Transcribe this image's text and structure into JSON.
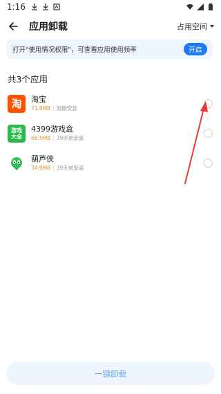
{
  "status_bar": {
    "time": "1:16",
    "left_icons": [
      "download-icon",
      "download-icon",
      "notification-icon"
    ],
    "right_icons": [
      "wifi-icon",
      "signal-icon",
      "battery-icon"
    ]
  },
  "app_bar": {
    "title": "应用卸载",
    "sort_label": "占用空间"
  },
  "banner": {
    "text": "打开\"使用情况权限\"，可查看应用使用频率",
    "button_label": "开启"
  },
  "section_title": "共3个应用",
  "apps": [
    {
      "name": "淘宝",
      "size": "71.9MB",
      "installed": "刚刚安装",
      "icon": "taobao-icon",
      "icon_text": "淘",
      "selected": false
    },
    {
      "name": "4399游戏盒",
      "size": "66.5MB",
      "installed": "39天前安装",
      "icon": "game-box-icon",
      "icon_text": "游戏大全",
      "selected": false
    },
    {
      "name": "葫芦侠",
      "size": "34.9MB",
      "installed": "39天前安装",
      "icon": "huluxia-icon",
      "icon_text": "",
      "selected": false
    }
  ],
  "uninstall_button_label": "一键卸载",
  "colors": {
    "accent": "#1f7af2",
    "banner_bg": "#eef5fe",
    "size_text": "#e8902b",
    "taobao": "#ff5000",
    "game_box": "#2db84b",
    "annotation": "#e53935"
  }
}
